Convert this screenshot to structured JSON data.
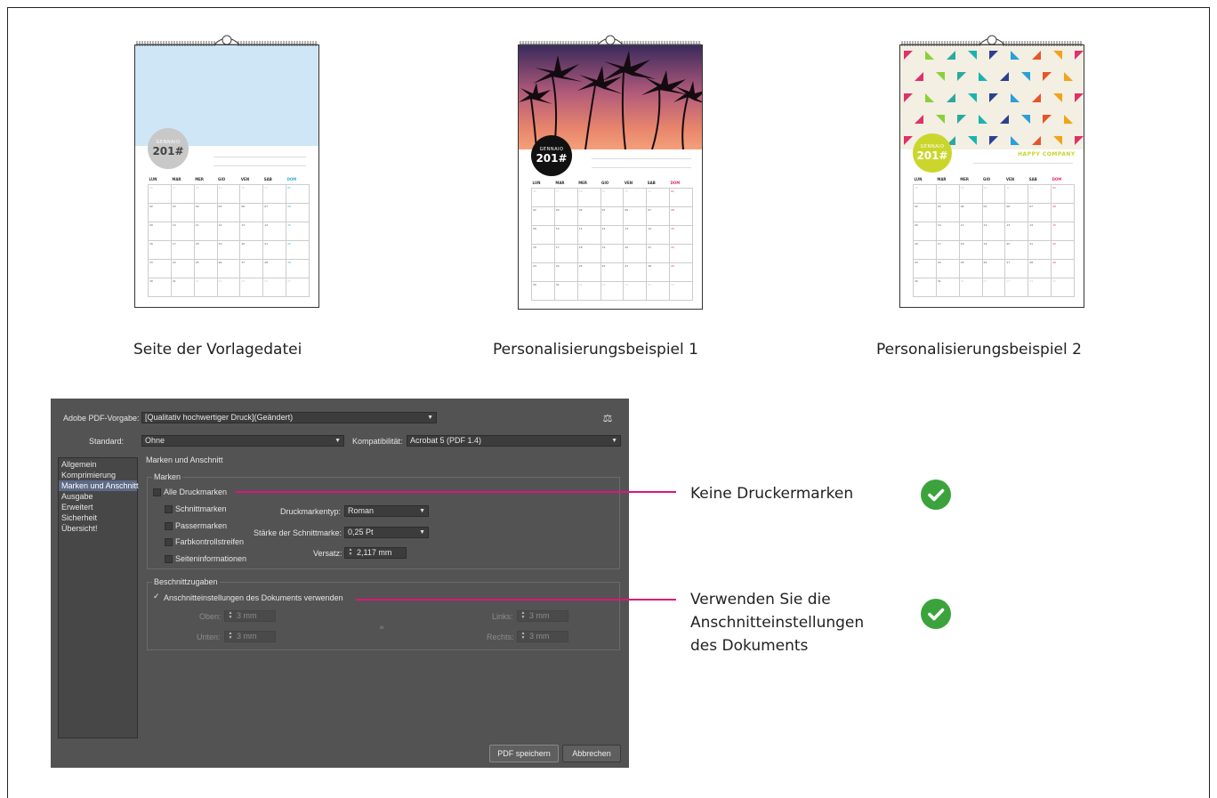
{
  "captions": {
    "template": "Seite der Vorlagedatei",
    "example1": "Personalisierungsbeispiel 1",
    "example2": "Personalisierungsbeispiel 2"
  },
  "calendar": {
    "month": "GENNAIO",
    "year": "201#",
    "company": "HAPPY COMPANY",
    "weekdays": [
      "LUN",
      "MAR",
      "MER",
      "GIO",
      "VEN",
      "SAB",
      "DOM"
    ],
    "weeks": [
      [
        "26",
        "27",
        "28",
        "29",
        "30",
        "31",
        "01"
      ],
      [
        "02",
        "03",
        "04",
        "05",
        "06",
        "07",
        "08"
      ],
      [
        "09",
        "10",
        "11",
        "12",
        "13",
        "14",
        "15"
      ],
      [
        "16",
        "17",
        "18",
        "19",
        "20",
        "21",
        "22"
      ],
      [
        "23",
        "24",
        "25",
        "26",
        "27",
        "28",
        "29"
      ],
      [
        "30",
        "31",
        "01",
        "02",
        "03",
        "04",
        "05"
      ]
    ]
  },
  "dialog": {
    "preset_label": "Adobe PDF-Vorgabe:",
    "preset_value": "[Qualitativ hochwertiger Druck](Geändert)",
    "standard_label": "Standard:",
    "standard_value": "Ohne",
    "compat_label": "Kompatibilität:",
    "compat_value": "Acrobat 5 (PDF 1.4)",
    "sidebar": [
      "Allgemein",
      "Komprimierung",
      "Marken und Anschnitt",
      "Ausgabe",
      "Erweitert",
      "Sicherheit",
      "Übersicht!"
    ],
    "sidebar_active": "Marken und Anschnitt",
    "section_title": "Marken und Anschnitt",
    "marks_group": "Marken",
    "all_marks": "Alle Druckmarken",
    "crop_marks": "Schnittmarken",
    "reg_marks": "Passermarken",
    "color_bars": "Farbkontrollstreifen",
    "page_info": "Seiteninformationen",
    "mark_type_label": "Druckmarkentyp:",
    "mark_type_value": "Roman",
    "weight_label": "Stärke der Schnittmarke:",
    "weight_value": "0,25 Pt",
    "offset_label": "Versatz:",
    "offset_value": "2,117 mm",
    "bleed_group": "Beschnittzugaben",
    "use_doc_bleed": "Anschnitteinstellungen des Dokuments verwenden",
    "top_label": "Oben:",
    "top_value": "3 mm",
    "bottom_label": "Unten:",
    "bottom_value": "3 mm",
    "left_label": "Links:",
    "left_value": "3 mm",
    "right_label": "Rechts:",
    "right_value": "3 mm",
    "save_button": "PDF speichern",
    "cancel_button": "Abbrechen",
    "save_preset_icon": "save-preset-icon"
  },
  "annotations": {
    "no_marks": "Keine Druckermarken",
    "use_bleed_1": "Verwenden Sie die",
    "use_bleed_2": "Anschnitteinstellungen",
    "use_bleed_3": "des Dokuments",
    "check_icon": "check-circle-icon",
    "accent_color": "#e0147a",
    "ok_color": "#3ca33c"
  }
}
